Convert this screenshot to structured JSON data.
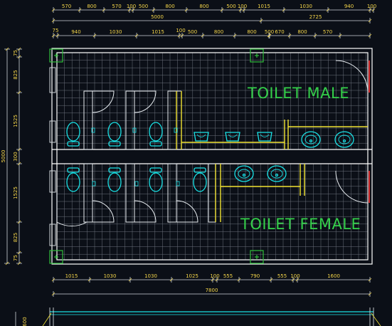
{
  "dims": {
    "top_row1": [
      "570",
      "800",
      "570",
      "100",
      "500",
      "800",
      "800",
      "500",
      "100",
      "1015",
      "1030",
      "940",
      "100"
    ],
    "top_total_left": "5000",
    "top_total_right": "2725",
    "top_row3_left": "75",
    "top_row3": [
      "940",
      "1030",
      "1015",
      "100",
      "500",
      "800",
      "800",
      "500",
      "670",
      "800",
      "570"
    ],
    "left_side": [
      "75",
      "825",
      "1525",
      "300",
      "1525",
      "825",
      "75"
    ],
    "left_total": "5000",
    "bottom_row": [
      "1015",
      "1030",
      "1030",
      "1025",
      "100",
      "555",
      "790",
      "555",
      "100",
      "1600"
    ],
    "bottom_total": "7800",
    "bottom_edge": "600"
  },
  "labels": {
    "male": "TOILET  MALE",
    "female": "TOILET  FEMALE"
  },
  "colors": {
    "grid": "#6d737d",
    "wall": "#ffffff",
    "fixture": "#19e2e6",
    "partition": "#f2e332",
    "door": "#e9eef2",
    "text_label": "#2fd04a",
    "dim_text": "#f5d64a",
    "column": "#2fbf3a",
    "door_red": "#d12a2a"
  }
}
